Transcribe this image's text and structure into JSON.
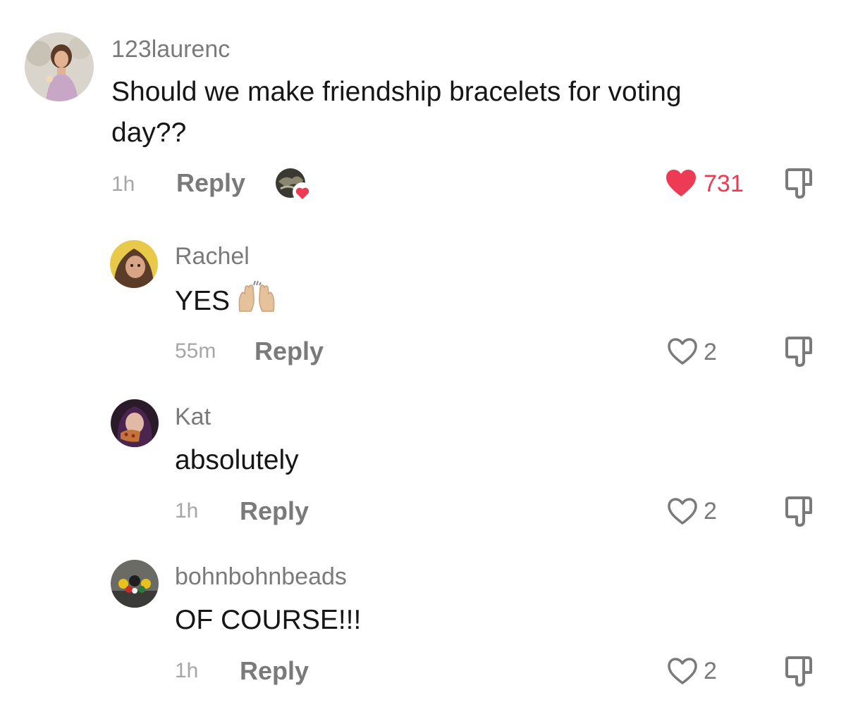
{
  "colors": {
    "liked_heart": "#ee3b55",
    "liked_count": "#ee3b55",
    "username": "#7a7a7a",
    "timestamp": "#a6a6a6",
    "reply": "#7a7a7a",
    "text": "#161616",
    "icon_stroke": "#7a7a7a"
  },
  "comment": {
    "username": "123laurenc",
    "text_line1": "Should we make friendship bracelets for voting",
    "text_line2": "day??",
    "time": "1h",
    "reply_label": "Reply",
    "creator_liked": true,
    "likes": "731",
    "liked": true
  },
  "replies": [
    {
      "username": "Rachel",
      "text": "YES",
      "emoji": "raising-hands",
      "time": "55m",
      "reply_label": "Reply",
      "likes": "2",
      "liked": false
    },
    {
      "username": "Kat",
      "text": "absolutely",
      "time": "1h",
      "reply_label": "Reply",
      "likes": "2",
      "liked": false
    },
    {
      "username": "bohnbohnbeads",
      "text": "OF COURSE!!!",
      "time": "1h",
      "reply_label": "Reply",
      "likes": "2",
      "liked": false
    }
  ]
}
